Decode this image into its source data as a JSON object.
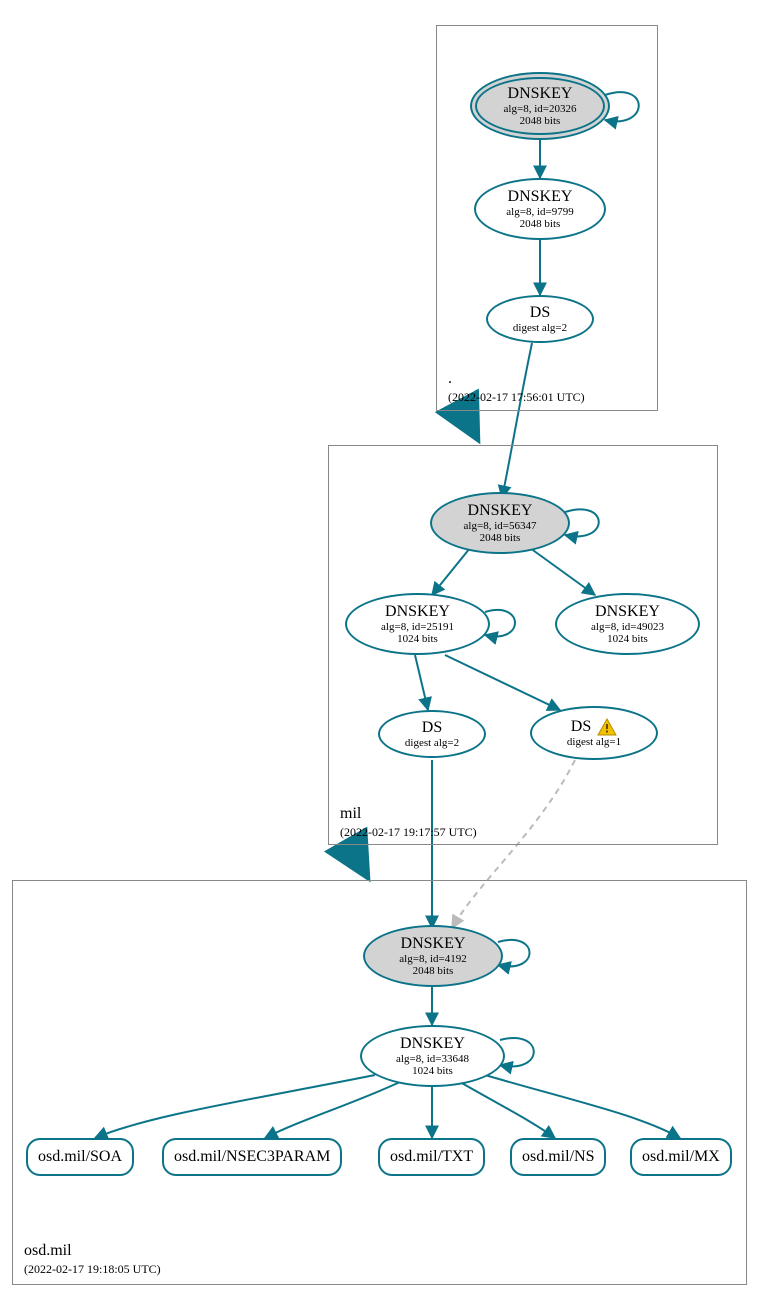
{
  "zones": {
    "root": {
      "label": ".",
      "timestamp": "(2022-02-17 17:56:01 UTC)"
    },
    "mil": {
      "label": "mil",
      "timestamp": "(2022-02-17 19:17:57 UTC)"
    },
    "osd": {
      "label": "osd.mil",
      "timestamp": "(2022-02-17 19:18:05 UTC)"
    }
  },
  "nodes": {
    "root_ksk": {
      "title": "DNSKEY",
      "sub1": "alg=8, id=20326",
      "sub2": "2048 bits"
    },
    "root_zsk": {
      "title": "DNSKEY",
      "sub1": "alg=8, id=9799",
      "sub2": "2048 bits"
    },
    "root_ds": {
      "title": "DS",
      "sub1": "digest alg=2"
    },
    "mil_ksk": {
      "title": "DNSKEY",
      "sub1": "alg=8, id=56347",
      "sub2": "2048 bits"
    },
    "mil_zsk1": {
      "title": "DNSKEY",
      "sub1": "alg=8, id=25191",
      "sub2": "1024 bits"
    },
    "mil_zsk2": {
      "title": "DNSKEY",
      "sub1": "alg=8, id=49023",
      "sub2": "1024 bits"
    },
    "mil_ds1": {
      "title": "DS",
      "sub1": "digest alg=2"
    },
    "mil_ds2": {
      "title": "DS",
      "sub1": "digest alg=1"
    },
    "osd_ksk": {
      "title": "DNSKEY",
      "sub1": "alg=8, id=4192",
      "sub2": "2048 bits"
    },
    "osd_zsk": {
      "title": "DNSKEY",
      "sub1": "alg=8, id=33648",
      "sub2": "1024 bits"
    }
  },
  "rr": {
    "soa": "osd.mil/SOA",
    "nsec3": "osd.mil/NSEC3PARAM",
    "txt": "osd.mil/TXT",
    "ns": "osd.mil/NS",
    "mx": "osd.mil/MX"
  },
  "colors": {
    "stroke": "#0c7489",
    "dashed": "#bbbbbb"
  }
}
